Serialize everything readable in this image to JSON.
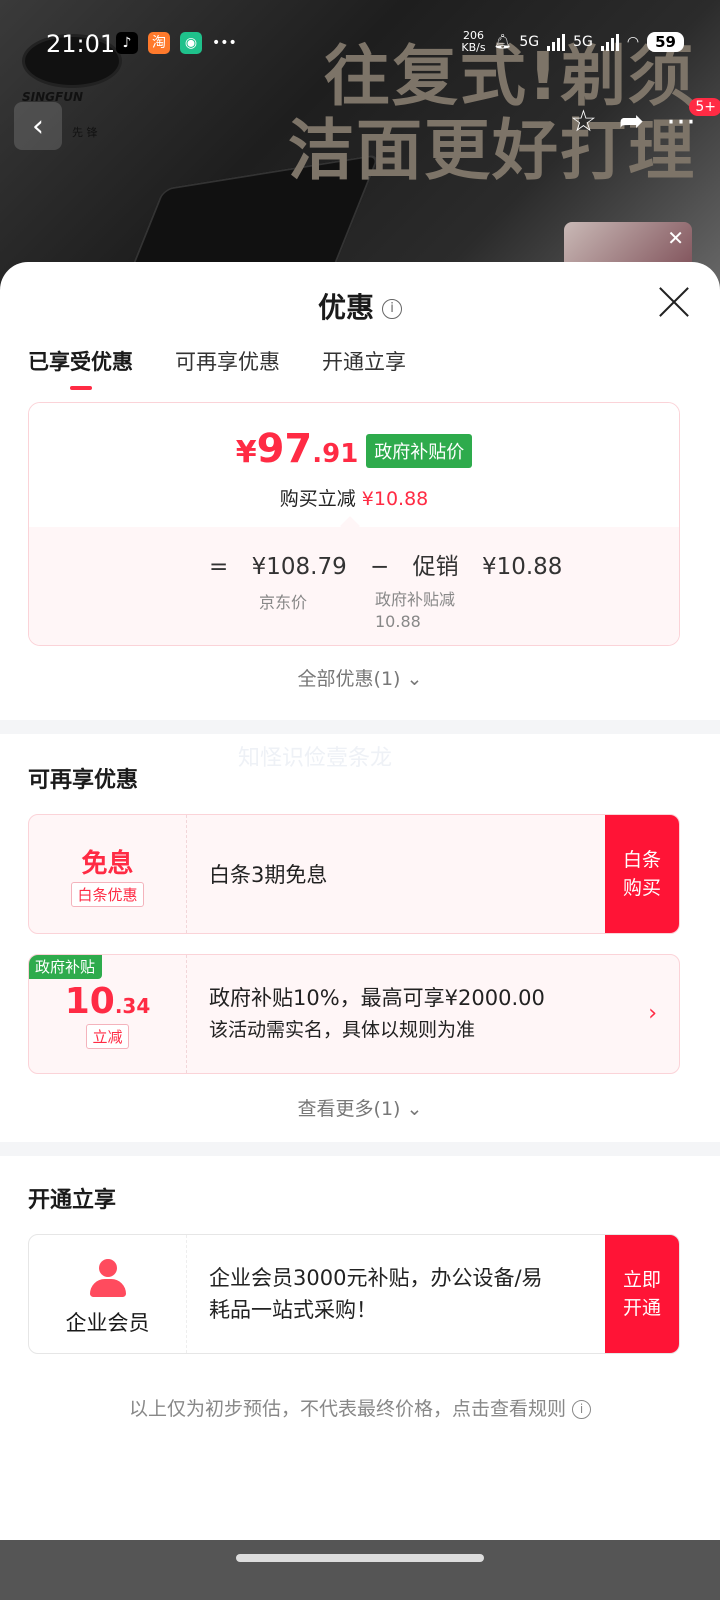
{
  "status_bar": {
    "time": "21:01",
    "net_speed_top": "206",
    "net_speed_unit": "KB/s",
    "sig1": "5G",
    "sig2": "5G",
    "battery": "59"
  },
  "banner": {
    "brand": "SINGFUN",
    "brand_cn": "先 锋",
    "headline_line1": "往复式!剃须",
    "headline_line2": "洁面更好打理",
    "badge": "5+"
  },
  "sheet": {
    "title": "优惠",
    "tabs": [
      {
        "label": "已享受优惠"
      },
      {
        "label": "可再享优惠"
      },
      {
        "label": "开通立享"
      }
    ]
  },
  "price_card": {
    "price_yen": "¥",
    "price_int": "97",
    "price_dec": ".91",
    "tag": "政府补贴价",
    "cut_label": "购买立减",
    "cut_value": "¥10.88",
    "eq": "=",
    "jd_price": "¥108.79",
    "minus": "−",
    "promo_label": "促销",
    "promo_value": "¥10.88",
    "jd_price_label": "京东价",
    "gov_cut_label": "政府补贴减",
    "gov_cut_value": "10.88"
  },
  "all_offers": "全部优惠(1)",
  "watermark": "知怪识俭壹条龙",
  "more_section": {
    "title": "可再享优惠",
    "card1": {
      "big": "免息",
      "tag": "白条优惠",
      "desc": "白条3期免息",
      "action_l1": "白条",
      "action_l2": "购买"
    },
    "card2": {
      "corner": "政府补贴",
      "amount_int": "10",
      "amount_dec": ".34",
      "tag": "立减",
      "line1": "政府补贴10%，最高可享¥2000.00",
      "line2": "该活动需实名，具体以规则为准"
    },
    "see_more": "查看更多(1)"
  },
  "open_section": {
    "title": "开通立享",
    "card": {
      "label": "企业会员",
      "desc_l1": "企业会员3000元补贴，办公设备/易",
      "desc_l2": "耗品一站式采购！",
      "action_l1": "立即",
      "action_l2": "开通"
    }
  },
  "footer_note": "以上仅为初步预估，不代表最终价格，点击查看规则"
}
